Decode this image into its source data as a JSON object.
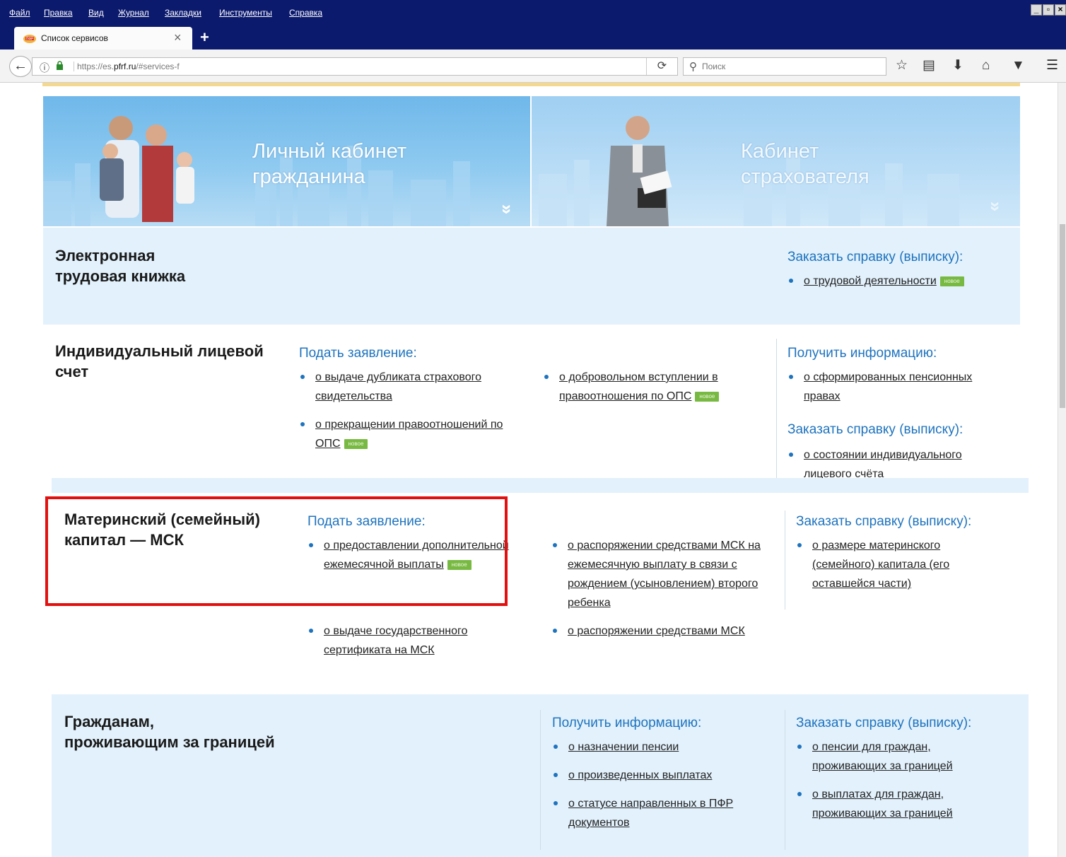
{
  "browser": {
    "menu": [
      "Файл",
      "Правка",
      "Вид",
      "Журнал",
      "Закладки",
      "Инструменты",
      "Справка"
    ],
    "tab_title": "Список сервисов",
    "url_prefix": "https://es.",
    "url_domain": "pfrf.ru",
    "url_suffix": "/#services-f",
    "search_placeholder": "Поиск",
    "icons": [
      "back-arrow-icon",
      "info-icon",
      "lock-icon",
      "reload-icon",
      "search-icon",
      "star-icon",
      "reading-list-icon",
      "download-icon",
      "home-icon",
      "pocket-icon",
      "menu-icon"
    ]
  },
  "banners": {
    "citizen": "Личный кабинет\nгражданина",
    "insurer": "Кабинет\nстрахователя"
  },
  "sections": {
    "etk": {
      "title": "Электронная\nтрудовая книжка",
      "order_head": "Заказать справку (выписку):",
      "order_item": "о трудовой деятельности"
    },
    "ils": {
      "title": "Индивидуальный лицевой\nсчет",
      "apply_head": "Подать заявление:",
      "apply_items": [
        "о выдаче дубликата страхового свидетельства",
        "о прекращении правоотношений по ОПС",
        "о добровольном вступлении в правоотношения по ОПС"
      ],
      "info_head": "Получить информацию:",
      "info_item": "о сформированных пенсионных правах",
      "order_head": "Заказать справку (выписку):",
      "order_item": "о состоянии индивидуального лицевого счёта"
    },
    "msk": {
      "title": "Материнский (семейный)\nкапитал — МСК",
      "apply_head": "Подать заявление:",
      "apply_items": [
        "о предоставлении дополнительной ежемесячной выплаты",
        "о выдаче государственного сертификата на МСК",
        "о распоряжении средствами МСК на ежемесячную выплату в связи с рождением (усыновлением) второго ребенка",
        "о распоряжении средствами МСК"
      ],
      "order_head": "Заказать справку (выписку):",
      "order_item": "о размере материнского (семейного) капитала (его оставшейся части)"
    },
    "abroad": {
      "title": "Гражданам,\nпроживающим за границей",
      "info_head": "Получить информацию:",
      "info_items": [
        "о назначении пенсии",
        "о произведенных выплатах",
        "о статусе направленных в ПФР документов"
      ],
      "order_head": "Заказать справку (выписку):",
      "order_items": [
        "о пенсии для граждан, проживающих за границей",
        "о выплатах для граждан, проживающих за границей"
      ]
    }
  },
  "new_badge": "новое",
  "colors": {
    "menubar": "#0c1a6e",
    "link_heading": "#1e73be",
    "section_bg": "#e2f1fc",
    "badge": "#78b943",
    "highlight": "#e31010"
  }
}
